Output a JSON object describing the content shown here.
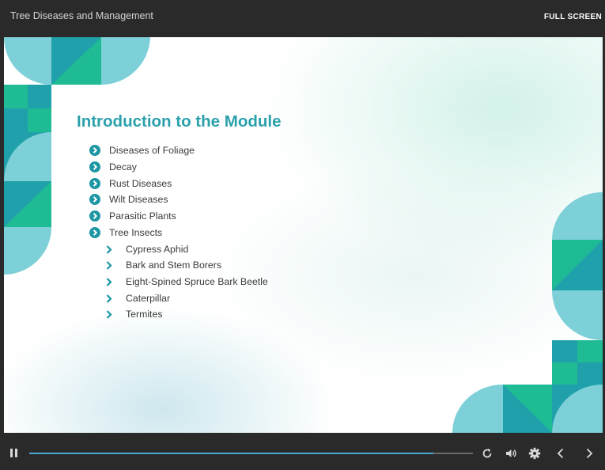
{
  "player": {
    "course_title": "Tree Diseases and Management",
    "fullscreen_label": "FULL SCREEN",
    "progress_fraction": 0.91
  },
  "slide": {
    "title": "Introduction to the Module",
    "items": [
      {
        "label": "Diseases of Foliage"
      },
      {
        "label": "Decay"
      },
      {
        "label": "Rust Diseases"
      },
      {
        "label": "Wilt Diseases"
      },
      {
        "label": "Parasitic Plants"
      },
      {
        "label": "Tree Insects"
      }
    ],
    "sub_items": [
      {
        "label": "Cypress Aphid"
      },
      {
        "label": "Bark and Stem Borers"
      },
      {
        "label": "Eight-Spined Spruce Bark Beetle"
      },
      {
        "label": "Caterpillar"
      },
      {
        "label": "Termites"
      }
    ]
  },
  "controls": {
    "icons": [
      "pause-icon",
      "replay-icon",
      "volume-icon",
      "settings-gear-icon",
      "chevron-left-icon",
      "chevron-right-icon"
    ]
  },
  "colors": {
    "accent": "#2aa0ab",
    "bullet": "#1e97a4",
    "progress": "#4aa7d6",
    "bar_background": "#2a2a2a"
  }
}
